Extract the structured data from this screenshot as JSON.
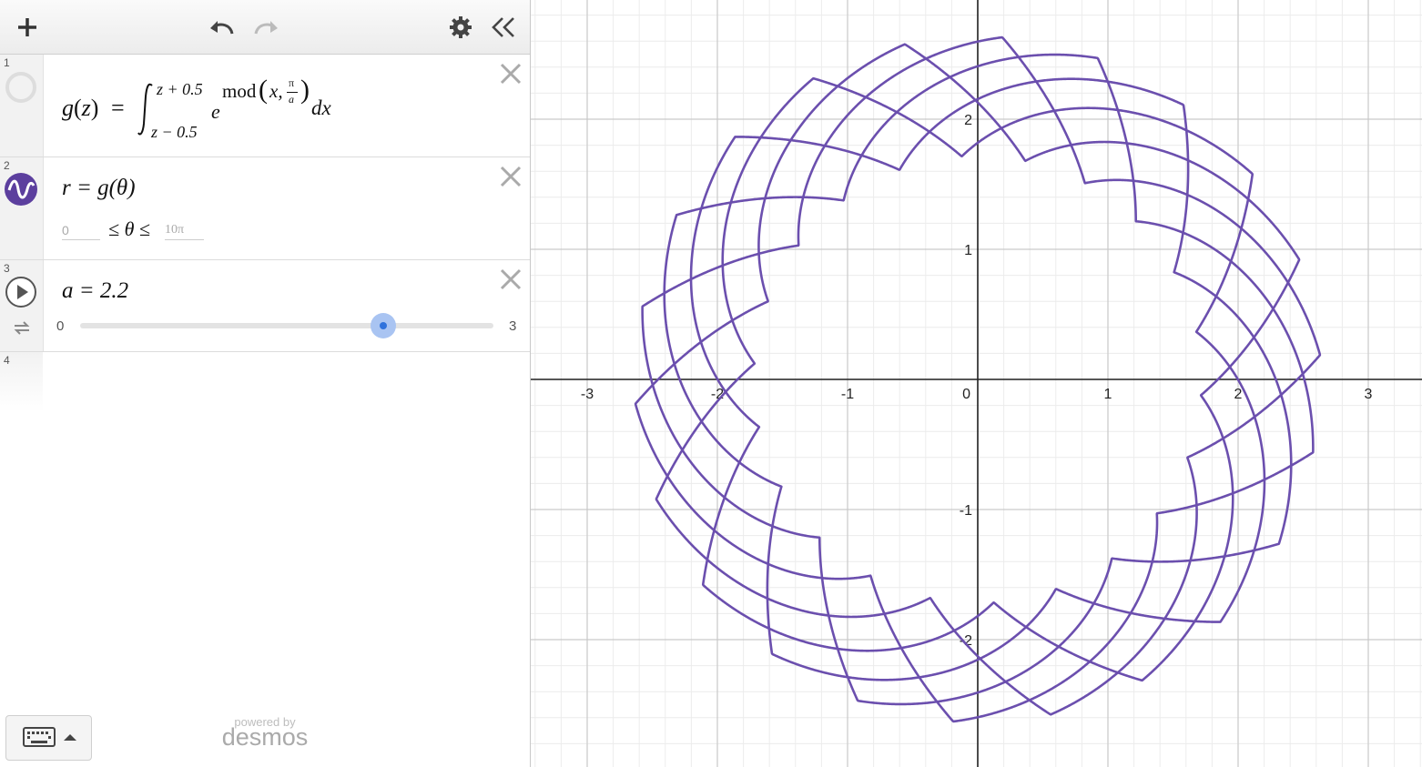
{
  "toolbar": {
    "add_icon": "plus-icon",
    "undo_icon": "undo-icon",
    "redo_icon": "redo-icon",
    "settings_icon": "gear-icon",
    "collapse_icon": "double-chevron-left-icon"
  },
  "expressions": [
    {
      "index": "1",
      "lhs": "g",
      "arg": "z",
      "upper": "z + 0.5",
      "lower": "z − 0.5",
      "base": "e",
      "fn": "mod",
      "x": "x,",
      "pi": "π",
      "a": "a",
      "dx": "dx"
    },
    {
      "index": "2",
      "text": "r = g(θ)",
      "min_placeholder": "0",
      "ineq": "≤ θ ≤",
      "max_placeholder": "10π"
    },
    {
      "index": "3",
      "text": "a = 2.2",
      "slider_min": "0",
      "slider_max": "3",
      "slider_value": 2.2
    },
    {
      "index": "4"
    }
  ],
  "footer": {
    "powered_by": "powered by",
    "brand": "desmos"
  },
  "graph": {
    "curve_color": "#6b4fae",
    "x_ticks": [
      "-3",
      "-2",
      "-1",
      "0",
      "1",
      "2",
      "3"
    ],
    "y_ticks": [
      "2",
      "1",
      "-1",
      "-2"
    ]
  },
  "chart_data": {
    "type": "line",
    "title": "",
    "xlabel": "",
    "ylabel": "",
    "xlim": [
      -3.4,
      3.4
    ],
    "ylim": [
      -2.9,
      2.9
    ],
    "grid": true,
    "series": [
      {
        "name": "",
        "expression": "r = g(θ), g(z) = ∫ e^{mod(x, π/a)} dx from z-0.5 to z+0.5",
        "theta_range": [
          0,
          31.4159
        ],
        "a": 2.2
      }
    ]
  }
}
